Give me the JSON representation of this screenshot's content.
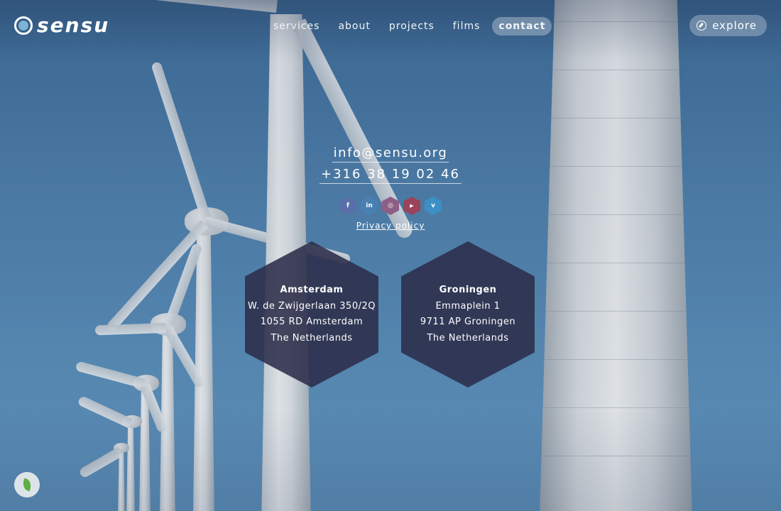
{
  "brand": {
    "logo_text": "sensu"
  },
  "nav": {
    "items": [
      "services",
      "about",
      "projects",
      "films",
      "contact"
    ],
    "active": "contact"
  },
  "explore_label": "explore",
  "contact": {
    "email": "info@sensu.org",
    "phone": "+316 38 19 02 46",
    "socials": [
      {
        "name": "facebook",
        "glyph": "f",
        "color": "#5a6fa8"
      },
      {
        "name": "linkedin",
        "glyph": "in",
        "color": "#4a7fb3"
      },
      {
        "name": "instagram",
        "glyph": "◎",
        "color": "#8e5f86"
      },
      {
        "name": "youtube",
        "glyph": "▶",
        "color": "#9b4358"
      },
      {
        "name": "vimeo",
        "glyph": "v",
        "color": "#3d8fc5"
      }
    ],
    "privacy_label": "Privacy policy"
  },
  "offices": [
    {
      "city": "Amsterdam",
      "line1": "W. de Zwijgerlaan 350/2Q",
      "line2": "1055 RD Amsterdam",
      "line3": "The Netherlands"
    },
    {
      "city": "Groningen",
      "line1": "Emmaplein 1",
      "line2": "9711 AP Groningen",
      "line3": "The Netherlands"
    }
  ],
  "colors": {
    "sky": "#4f81ad",
    "office_panel": "#2c2e4a",
    "leaf": "#5fb043"
  }
}
